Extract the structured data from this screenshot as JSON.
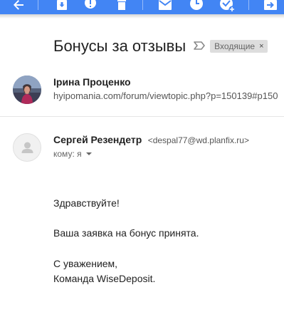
{
  "toolbar": {
    "background": "#4285f4",
    "icons": [
      "back-arrow-icon",
      "archive-icon",
      "report-spam-icon",
      "delete-icon",
      "mark-unread-icon",
      "snooze-icon",
      "add-to-tasks-icon",
      "move-to-icon"
    ]
  },
  "email": {
    "subject": "Бонусы за отзывы",
    "label": "Входящие",
    "label_remove": "×"
  },
  "message1": {
    "sender_name": "Ірина Проценко",
    "snippet": "hyipomania.com/forum/viewtopic.php?p=150139#p150"
  },
  "message2": {
    "sender_name": "Сергей Резендетр",
    "sender_email": "<despal77@wd.planfix.ru>",
    "recipient": "кому: я",
    "body": {
      "greeting": "Здравствуйте!",
      "line1": "Ваша заявка на бонус принята.",
      "signoff": "С уважением,",
      "signature": "Команда WiseDeposit."
    }
  }
}
